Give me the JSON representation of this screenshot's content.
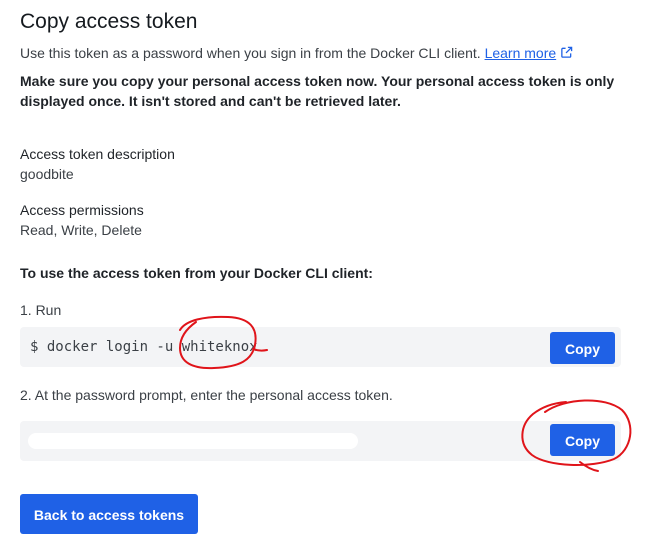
{
  "header": {
    "title": "Copy access token",
    "subtitle": "Use this token as a password when you sign in from the Docker CLI client.",
    "learn_more": "Learn more",
    "warning": "Make sure you copy your personal access token now. Your personal access token is only displayed once. It isn't stored and can't be retrieved later."
  },
  "token_info": {
    "description_label": "Access token description",
    "description_value": "goodbite",
    "permissions_label": "Access permissions",
    "permissions_value": "Read, Write, Delete"
  },
  "instructions": {
    "heading": "To use the access token from your Docker CLI client:",
    "step1_label": "1. Run",
    "step1_command": "$ docker login -u whiteknox",
    "step1_copy": "Copy",
    "step2_label": "2. At the password prompt, enter the personal access token.",
    "step2_copy": "Copy"
  },
  "footer": {
    "back_button": "Back to access tokens"
  },
  "colors": {
    "accent": "#1f61e6",
    "annotation": "#e0141a"
  },
  "icons": {
    "learn_more": "external-link-icon"
  }
}
